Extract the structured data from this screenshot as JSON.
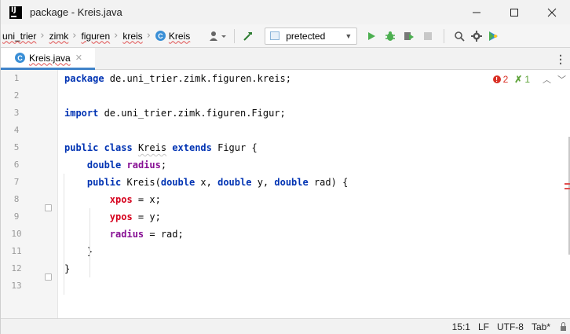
{
  "window": {
    "title": "package - Kreis.java"
  },
  "navbar": {
    "breadcrumbs": [
      "uni_trier",
      "zimk",
      "figuren",
      "kreis",
      "Kreis"
    ],
    "class_badge": "C",
    "run_config": "pretected"
  },
  "tabs": [
    {
      "label": "Kreis.java",
      "badge": "C",
      "active": true
    }
  ],
  "inspections": {
    "errors": "2",
    "warnings": "1",
    "error_glyph": "!",
    "warning_glyph": "✗"
  },
  "editor": {
    "line_numbers": [
      "1",
      "2",
      "3",
      "4",
      "5",
      "6",
      "7",
      "8",
      "9",
      "10",
      "11",
      "12",
      "13"
    ],
    "lines": [
      [
        {
          "t": "package",
          "c": "kw"
        },
        {
          "t": " de.uni_trier.zimk.figuren.kreis;",
          "c": ""
        }
      ],
      [],
      [
        {
          "t": "import",
          "c": "kw"
        },
        {
          "t": " de.uni_trier.zimk.figuren.Figur;",
          "c": ""
        }
      ],
      [],
      [
        {
          "t": "public class",
          "c": "kw"
        },
        {
          "t": " ",
          "c": ""
        },
        {
          "t": "Kreis",
          "c": "squig"
        },
        {
          "t": " ",
          "c": ""
        },
        {
          "t": "extends",
          "c": "kw"
        },
        {
          "t": " Figur {",
          "c": ""
        }
      ],
      [
        {
          "t": "    ",
          "c": ""
        },
        {
          "t": "double",
          "c": "kw"
        },
        {
          "t": " ",
          "c": ""
        },
        {
          "t": "radius",
          "c": "field"
        },
        {
          "t": ";",
          "c": ""
        }
      ],
      [
        {
          "t": "    ",
          "c": ""
        },
        {
          "t": "public",
          "c": "kw"
        },
        {
          "t": " Kreis(",
          "c": ""
        },
        {
          "t": "double",
          "c": "kw"
        },
        {
          "t": " x, ",
          "c": ""
        },
        {
          "t": "double",
          "c": "kw"
        },
        {
          "t": " y, ",
          "c": ""
        },
        {
          "t": "double",
          "c": "kw"
        },
        {
          "t": " rad) {",
          "c": ""
        }
      ],
      [
        {
          "t": "        ",
          "c": ""
        },
        {
          "t": "xpos",
          "c": "assign"
        },
        {
          "t": " = x;",
          "c": ""
        }
      ],
      [
        {
          "t": "        ",
          "c": ""
        },
        {
          "t": "ypos",
          "c": "assign"
        },
        {
          "t": " = y;",
          "c": ""
        }
      ],
      [
        {
          "t": "        ",
          "c": ""
        },
        {
          "t": "radius",
          "c": "field"
        },
        {
          "t": " = rad;",
          "c": ""
        }
      ],
      [
        {
          "t": "    }",
          "c": ""
        }
      ],
      [
        {
          "t": "}",
          "c": ""
        }
      ],
      []
    ]
  },
  "status": {
    "position": "15:1",
    "line_separator": "LF",
    "encoding": "UTF-8",
    "indent": "Tab*"
  },
  "colors": {
    "keyword": "#0033b3",
    "field": "#871094",
    "error_field": "#d6001c",
    "run": "#4caf50",
    "tab_underline": "#4083c9"
  }
}
